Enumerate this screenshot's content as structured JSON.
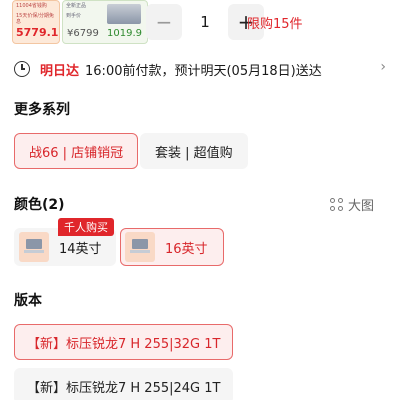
{
  "top": {
    "thumb1_lines": [
      "11004省钱购",
      "15天价保/分期免息"
    ],
    "thumb1_price": "5779.15",
    "thumb2_lines": [
      "全新正品",
      "到手价"
    ],
    "thumb2_price_old": "¥6799",
    "thumb2_price_new": "1019.9",
    "minus": "−",
    "quantity": "1",
    "plus": "+",
    "limit": "限购15件"
  },
  "delivery": {
    "tag": "明日达",
    "text": "16:00前付款，预计明天(05月18日)送达",
    "chevron": "›"
  },
  "series": {
    "title": "更多系列",
    "items": [
      "战66 | 店铺销冠",
      "套装 | 超值购"
    ]
  },
  "color": {
    "title": "颜色(2)",
    "big_pic": "大图",
    "badge": "千人购买",
    "items": [
      "14英寸",
      "16英寸"
    ]
  },
  "version": {
    "title": "版本",
    "items": [
      "【新】标压锐龙7 H 255|32G 1T",
      "【新】标压锐龙7 H 255|24G 1T"
    ]
  },
  "colors": {
    "accent": "#e0262b",
    "chip_bg": "#f5f5f5",
    "active_bg": "#fdeeee"
  }
}
